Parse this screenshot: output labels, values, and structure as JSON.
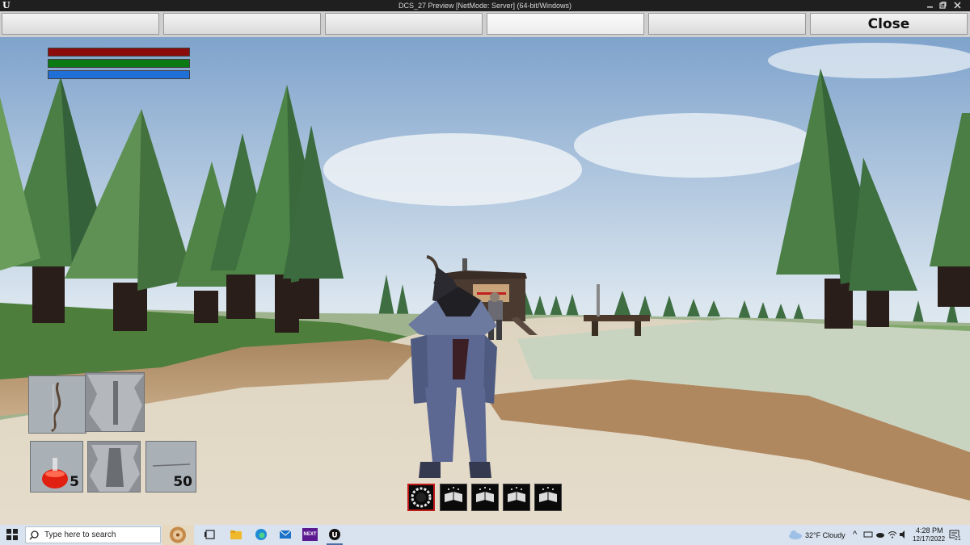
{
  "window": {
    "title": "DCS_27 Preview [NetMode: Server]  (64-bit/Windows)",
    "app_icon": "unreal-engine-icon",
    "controls": [
      "minimize-icon",
      "restore-icon",
      "close-icon"
    ]
  },
  "menu": {
    "buttons": [
      "",
      "",
      "",
      "",
      "",
      "Close"
    ],
    "highlighted_index": 3
  },
  "hud": {
    "bars": [
      {
        "name": "health",
        "color": "#8b0b0b"
      },
      {
        "name": "stamina",
        "color": "#0b7a12"
      },
      {
        "name": "mana",
        "color": "#1f6fd6"
      }
    ],
    "inventory": [
      {
        "item": "bow",
        "qty": ""
      },
      {
        "item": "empty-slot",
        "qty": ""
      },
      {
        "item": "health-potion",
        "qty": "5"
      },
      {
        "item": "empty-slot",
        "qty": ""
      },
      {
        "item": "arrow",
        "qty": "50"
      }
    ],
    "skills": [
      "portal-icon",
      "spellbook-icon",
      "spellbook-icon",
      "spellbook-icon",
      "spellbook-icon"
    ],
    "active_skill_index": 0
  },
  "taskbar": {
    "start_icon": "windows-start-icon",
    "search_placeholder": "Type here to search",
    "pinned": [
      "task-view-icon",
      "file-explorer-icon",
      "edge-icon",
      "mail-icon",
      "next-icon",
      "unreal-editor-icon"
    ],
    "next_label": "NEXT",
    "weather": "32°F  Cloudy",
    "time": "4:28 PM",
    "date": "12/17/2022",
    "notification_count": "21"
  }
}
